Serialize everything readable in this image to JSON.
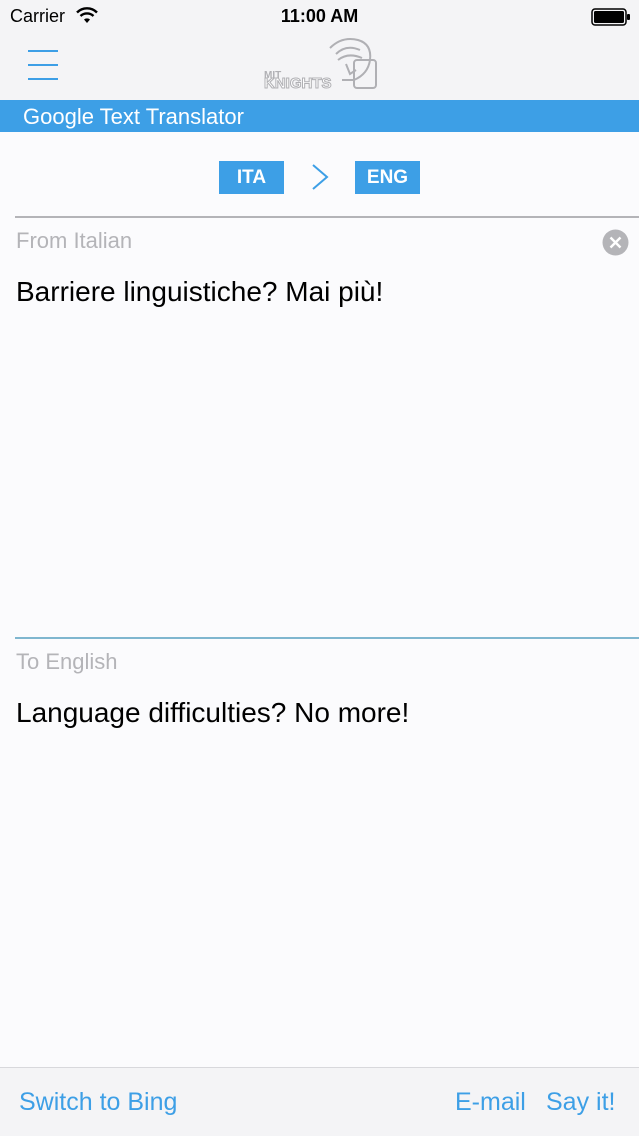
{
  "status_bar": {
    "carrier": "Carrier",
    "time": "11:00 AM"
  },
  "nav_bar": {
    "logo_text": "KNIGHTS",
    "menu_icon": "hamburger-icon"
  },
  "banner": {
    "title": "Google Text Translator"
  },
  "languages": {
    "from_code": "ITA",
    "to_code": "ENG",
    "swap_icon": "chevron-right-icon"
  },
  "source": {
    "label": "From Italian",
    "text": "Barriere linguistiche? Mai più!",
    "clear_icon": "clear-icon"
  },
  "target": {
    "label": "To English",
    "text": "Language difficulties? No more!"
  },
  "toolbar": {
    "switch_label": "Switch to Bing",
    "email_label": "E-mail",
    "say_label": "Say it!"
  },
  "colors": {
    "accent": "#3d9fe6",
    "label_gray": "#b4b4b8",
    "divider_blue": "#7fb6cf"
  }
}
